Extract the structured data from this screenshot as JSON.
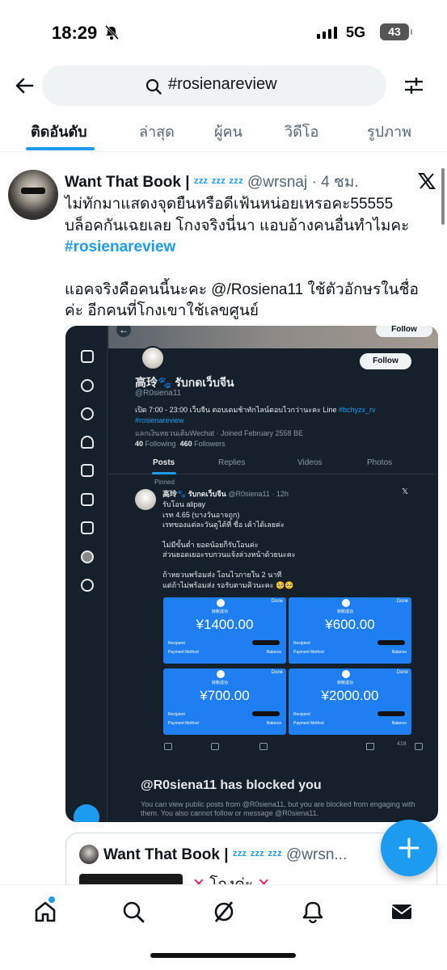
{
  "status_bar": {
    "time": "18:29",
    "network": "5G",
    "battery": "43"
  },
  "search": {
    "value": "#rosienareview"
  },
  "tabs": [
    {
      "label": "ติดอันดับ",
      "active": true
    },
    {
      "label": "ล่าสุด",
      "active": false
    },
    {
      "label": "ผู้คน",
      "active": false
    },
    {
      "label": "วิดีโอ",
      "active": false
    },
    {
      "label": "รูปภาพ",
      "active": false
    }
  ],
  "post": {
    "author": "Want That Book",
    "separator": "|",
    "zzz": "ᶻᶻᶻ ᶻᶻᶻ ᶻᶻᶻ",
    "handle": "@wrsnaj",
    "time": "· 4 ชม.",
    "text_line1": "ไม่ทักมาแสดงจุดยืนหรือดีเฟ้นหน่อยเหรอคะ55555",
    "text_line2": "บล็อคกันเฉยเลย โกงจริงนี่นา แอบอ้างคนอื่นทำไมคะ",
    "hashtag": "#rosienareview",
    "text_para2": "แอคจริงคือคนนี้นะคะ @/Rosiena11 ใช้ตัวอักษรในชื่อค่ะ อีกคนที่โกงเขาใช้เลขศูนย์"
  },
  "media": {
    "follow_top": "Follow",
    "follow": "Follow",
    "profile_name": "高玲🐾 รับกดเว็บจีน",
    "profile_handle": "@R0siena11",
    "bio": "เปิด 7:00 - 23:00 เว็บจีน ตอบเดมช้าทักไลน์ตอบไวกว่านะคะ Line",
    "bio_link": "#bchyzx_rv",
    "bio_tag": "#rosienareview",
    "meta": "แลกเงินหยวนเติมWechat · Joined February 2558 BE",
    "following_count": "40",
    "following_label": "Following",
    "followers_count": "460",
    "followers_label": "Followers",
    "tabs": [
      "Posts",
      "Replies",
      "Videos",
      "Photos"
    ],
    "pinned": "Pinned",
    "tweet_name": "高玲🐾 รับกดเว็บจีน",
    "tweet_handle": "@R0siena11 · 12h",
    "tweet_lines": [
      "รับโอน alipay",
      "เรท 4.65 (บางวันอาจถูก)",
      "เรทของแต่ละวันดูได้ที่ ชื่อ เค้าได้เลยค่ะ",
      "",
      "ไม่มีขั้นต่ำ ยอดน้อยก็รับโอนค่ะ",
      "ส่วนยอดเยอะรบกวนแจ้งล่วงหน้าด้วยนะคะ",
      "",
      "ถ้าหยวนพร้อมส่ง โอนไวภายใน 2 นาที",
      "แต่ถ้าไม่พร้อมส่ง รอรับตามคิวนะคะ 🥺🥺"
    ],
    "receipts": [
      {
        "amount": "¥1400.00",
        "done": "Done",
        "sub": "转账成功",
        "recipient": "Recipient",
        "payment": "Payment Method",
        "balance": "Balance"
      },
      {
        "amount": "¥600.00",
        "done": "Done",
        "sub": "转账成功",
        "recipient": "Recipient",
        "payment": "Payment Method",
        "balance": "Balance"
      },
      {
        "amount": "¥700.00",
        "done": "Done",
        "sub": "转账成功",
        "recipient": "Recipient",
        "payment": "Payment Method",
        "balance": "Balance"
      },
      {
        "amount": "¥2000.00",
        "done": "Done",
        "sub": "转账成功",
        "recipient": "Recipient",
        "payment": "Payment Method",
        "balance": "Balance"
      }
    ],
    "views": "418",
    "blocked_title": "@R0siena11 has blocked you",
    "blocked_sub": "You can view public posts from @R0siena11, but you are blocked from engaging with them. You also cannot follow or message @R0siena11."
  },
  "quoted": {
    "author": "Want That Book",
    "separator": "|",
    "zzz": "ᶻᶻᶻ ᶻᶻᶻ ᶻᶻᶻ",
    "handle": "@wrsn...",
    "text": "โกงค่ะ"
  },
  "colors": {
    "accent": "#1d9bf0",
    "media_bg": "#15202b",
    "receipt_blue": "#1f7ff2"
  }
}
